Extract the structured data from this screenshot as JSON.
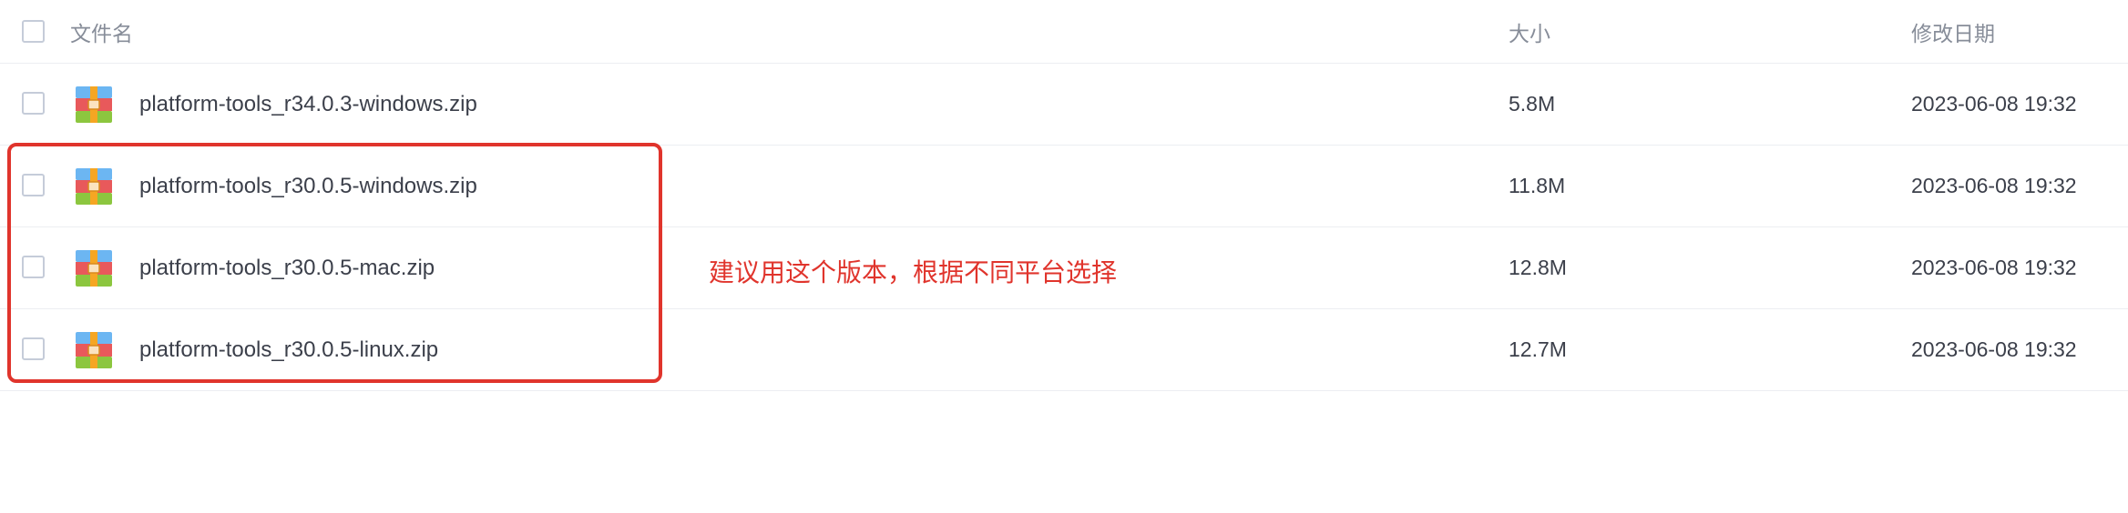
{
  "header": {
    "name_label": "文件名",
    "size_label": "大小",
    "date_label": "修改日期"
  },
  "files": [
    {
      "name": "platform-tools_r34.0.3-windows.zip",
      "size": "5.8M",
      "modified": "2023-06-08 19:32",
      "icon": "archive-zip-icon"
    },
    {
      "name": "platform-tools_r30.0.5-windows.zip",
      "size": "11.8M",
      "modified": "2023-06-08 19:32",
      "icon": "archive-zip-icon"
    },
    {
      "name": "platform-tools_r30.0.5-mac.zip",
      "size": "12.8M",
      "modified": "2023-06-08 19:32",
      "icon": "archive-zip-icon"
    },
    {
      "name": "platform-tools_r30.0.5-linux.zip",
      "size": "12.7M",
      "modified": "2023-06-08 19:32",
      "icon": "archive-zip-icon"
    }
  ],
  "annotation": {
    "text": "建议用这个版本，根据不同平台选择",
    "color": "#e0342c"
  },
  "colors": {
    "checkbox_border": "#c5ccd9",
    "row_divider": "#eceef2",
    "header_text": "#878d99",
    "body_text": "#3b3f4a"
  }
}
